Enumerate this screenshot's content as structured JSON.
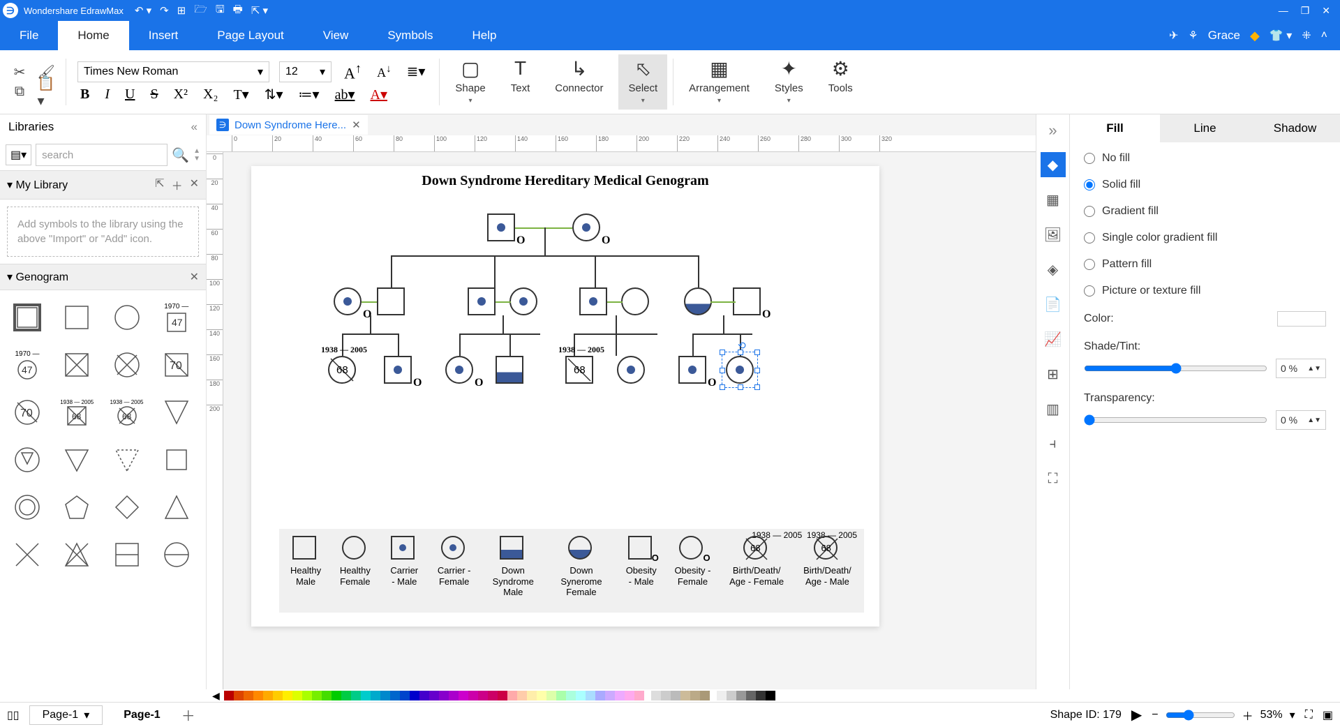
{
  "app_name": "Wondershare EdrawMax",
  "user_name": "Grace",
  "menu": [
    "File",
    "Home",
    "Insert",
    "Page Layout",
    "View",
    "Symbols",
    "Help"
  ],
  "active_menu": "Home",
  "font_family": "Times New Roman",
  "font_size": "12",
  "tools": {
    "shape": "Shape",
    "text": "Text",
    "connector": "Connector",
    "select": "Select",
    "arrangement": "Arrangement",
    "styles": "Styles",
    "tools": "Tools"
  },
  "libraries_label": "Libraries",
  "search_placeholder": "search",
  "my_library_label": "My Library",
  "my_library_hint": "Add symbols to the library using the above \"Import\" or \"Add\" icon.",
  "genogram_label": "Genogram",
  "doc_tab": "Down Syndrome Here...",
  "canvas_title": "Down Syndrome Hereditary Medical Genogram",
  "legend": {
    "items": [
      "Healthy Male",
      "Healthy Female",
      "Carrier - Male",
      "Carrier - Female",
      "Down Syndrome Male",
      "Down Synerome Female",
      "Obesity - Male",
      "Obesity - Female",
      "Birth/Death/ Age - Female",
      "Birth/Death/ Age - Male"
    ],
    "dates": [
      "1938 — 2005",
      "1938 — 2005"
    ],
    "age": "68"
  },
  "tree": {
    "dates_left": "1938 — 2005",
    "dates_right": "1938 — 2005",
    "age": "68"
  },
  "right_panel": {
    "tabs": [
      "Fill",
      "Line",
      "Shadow"
    ],
    "active": "Fill",
    "options": [
      "No fill",
      "Solid fill",
      "Gradient fill",
      "Single color gradient fill",
      "Pattern fill",
      "Picture or texture fill"
    ],
    "selected": "Solid fill",
    "color_label": "Color:",
    "shade_label": "Shade/Tint:",
    "shade_value": "0 %",
    "transparency_label": "Transparency:",
    "transparency_value": "0 %"
  },
  "status": {
    "page_dd": "Page-1",
    "page_tab": "Page-1",
    "shape_id": "Shape ID: 179",
    "zoom": "53%"
  },
  "ruler_ticks_h": [
    0,
    20,
    40,
    60,
    80,
    100,
    120,
    140,
    160,
    180,
    200,
    220,
    240,
    260,
    280,
    300,
    320
  ],
  "ruler_ticks_v": [
    0,
    20,
    40,
    60,
    80,
    100,
    120,
    140,
    160,
    180,
    200
  ]
}
